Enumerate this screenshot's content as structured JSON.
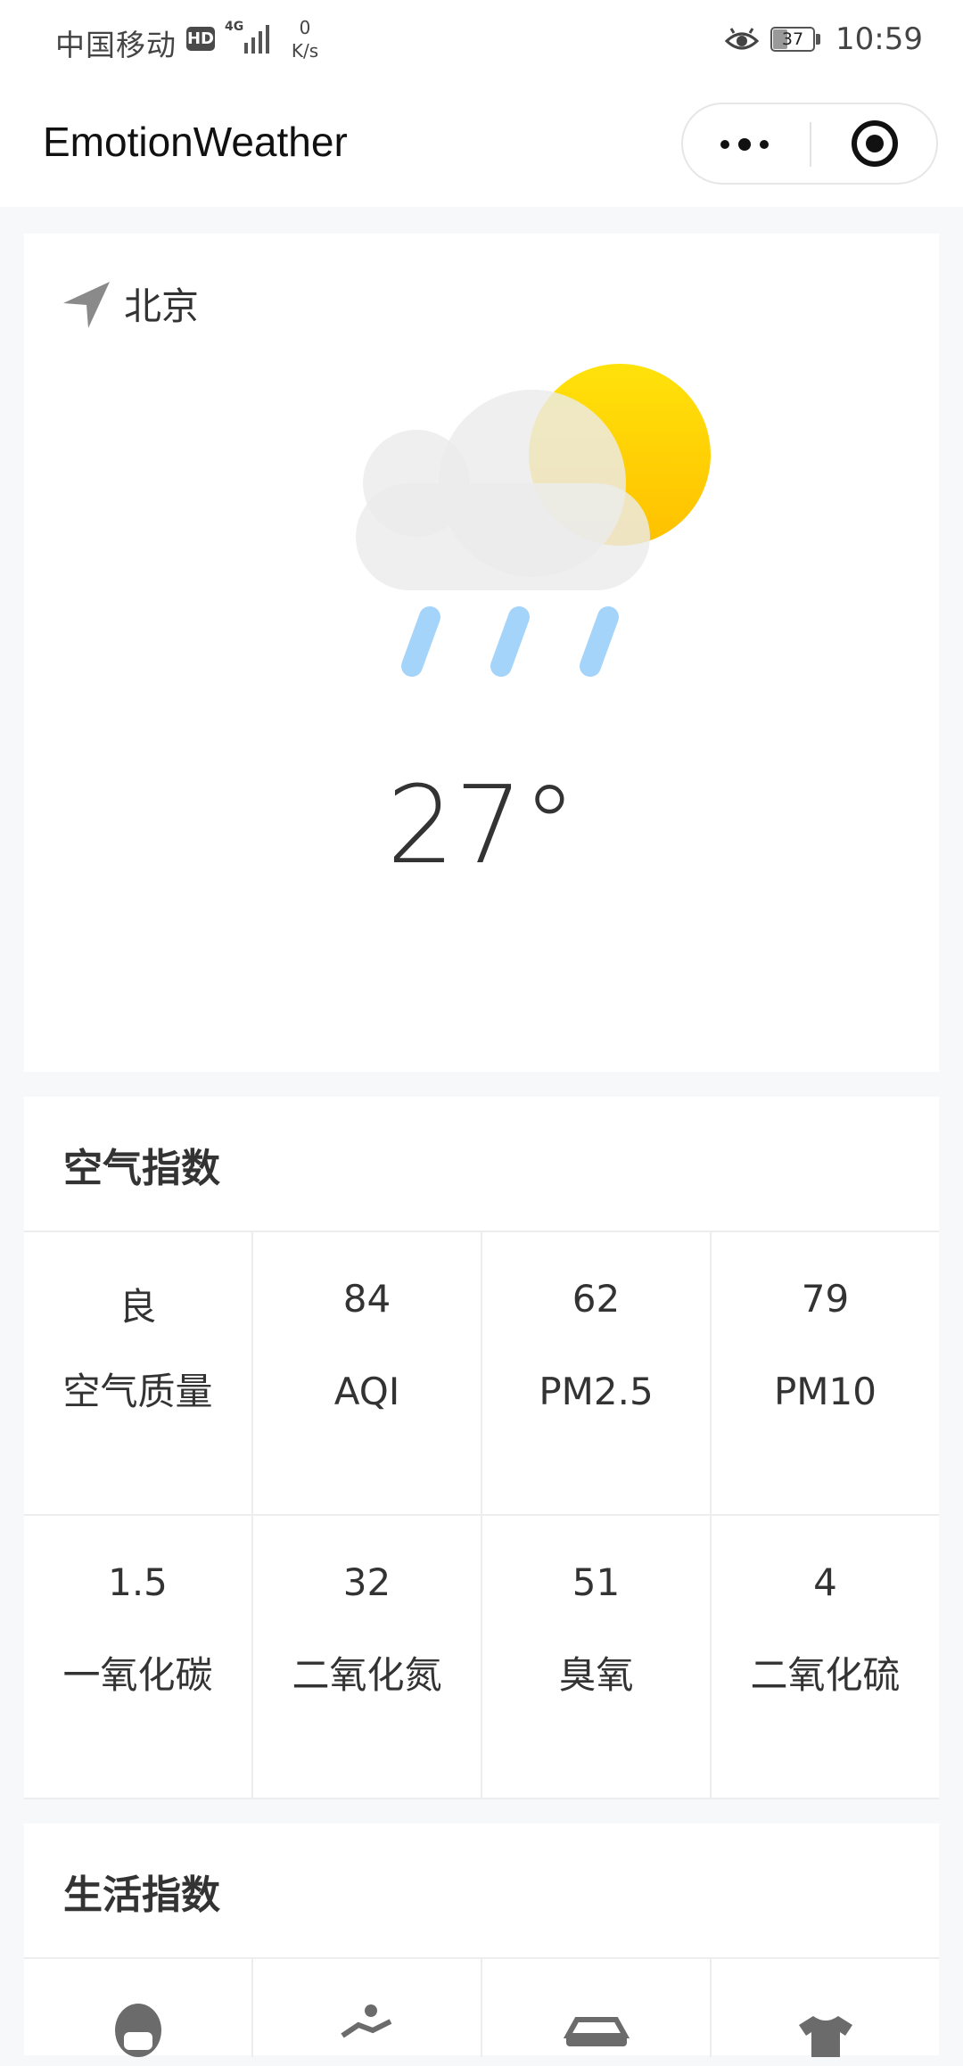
{
  "status_bar": {
    "carrier": "中国移动",
    "hd": "HD",
    "network": "4G",
    "speed_value": "0",
    "speed_unit": "K/s",
    "battery": "37",
    "battery_level": 0.37,
    "time": "10:59"
  },
  "nav": {
    "title": "EmotionWeather"
  },
  "weather": {
    "city": "北京",
    "temperature": "27°",
    "condition_icon": "cloud-sun-rain-icon"
  },
  "air": {
    "title": "空气指数",
    "rows": [
      [
        {
          "value": "良",
          "label": "空气质量"
        },
        {
          "value": "84",
          "label": "AQI"
        },
        {
          "value": "62",
          "label": "PM2.5"
        },
        {
          "value": "79",
          "label": "PM10"
        }
      ],
      [
        {
          "value": "1.5",
          "label": "一氧化碳"
        },
        {
          "value": "32",
          "label": "二氧化氮"
        },
        {
          "value": "51",
          "label": "臭氧"
        },
        {
          "value": "4",
          "label": "二氧化硫"
        }
      ]
    ]
  },
  "life": {
    "title": "生活指数",
    "icons": [
      "mask-icon",
      "sport-icon",
      "car-icon",
      "shirt-icon"
    ]
  },
  "colors": {
    "sun": "#ffd000",
    "cloud": "#eeeeee",
    "rain": "#a5d4fb",
    "text": "#333333",
    "divider": "#ededed"
  }
}
